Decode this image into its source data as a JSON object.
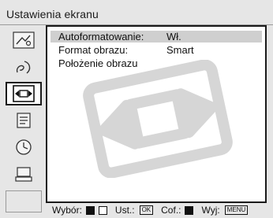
{
  "menu": {
    "title": "Ustawienia ekranu",
    "sidebar": {
      "items": [
        {
          "icon": "picture-adjust-icon",
          "active": false
        },
        {
          "icon": "sound-icon",
          "active": false
        },
        {
          "icon": "screen-control-icon",
          "active": true
        },
        {
          "icon": "setup-icon",
          "active": false
        },
        {
          "icon": "timer-icon",
          "active": false
        },
        {
          "icon": "pc-settings-icon",
          "active": false
        }
      ]
    },
    "items": [
      {
        "label": "Autoformatowanie:",
        "value": "Wł.",
        "selected": true
      },
      {
        "label": "Format obrazu:",
        "value": "Smart",
        "selected": false
      },
      {
        "label": "Położenie obrazu",
        "value": "",
        "selected": false
      }
    ],
    "footer": {
      "select_label": "Wybór:",
      "set_label": "Ust.:",
      "set_key": "OK",
      "back_label": "Cof.:",
      "exit_label": "Wyj:",
      "exit_key": "MENU"
    }
  }
}
